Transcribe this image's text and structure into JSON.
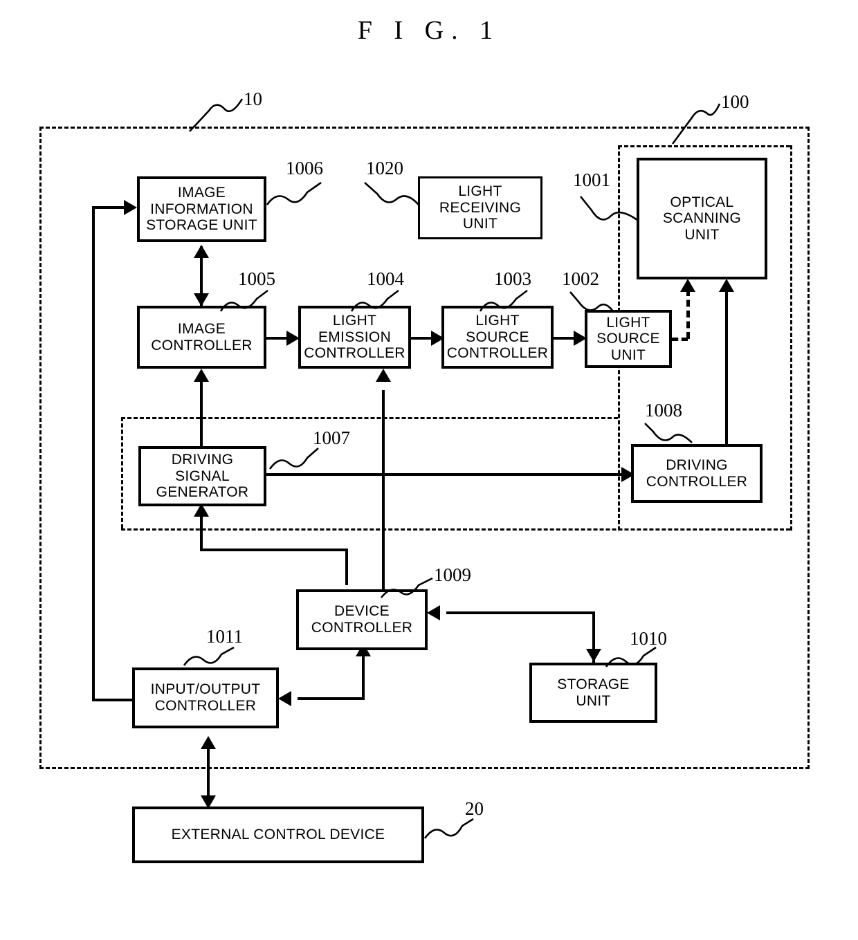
{
  "figure": {
    "title": "F I G.  1"
  },
  "regions": [
    {
      "id": "device-boundary",
      "ref": "10",
      "style": "dashed"
    },
    {
      "id": "optical-unit-boundary",
      "ref": "100",
      "style": "dash-dot"
    }
  ],
  "blocks": [
    {
      "id": "image-information-storage-unit",
      "ref": "1006",
      "label": "IMAGE\nINFORMATION\nSTORAGE UNIT"
    },
    {
      "id": "light-receiving-unit",
      "ref": "1020",
      "label": "LIGHT\nRECEIVING\nUNIT"
    },
    {
      "id": "optical-scanning-unit",
      "ref": "1001",
      "label": "OPTICAL\nSCANNING\nUNIT"
    },
    {
      "id": "image-controller",
      "ref": "1005",
      "label": "IMAGE\nCONTROLLER"
    },
    {
      "id": "light-emission-controller",
      "ref": "1004",
      "label": "LIGHT\nEMISSION\nCONTROLLER"
    },
    {
      "id": "light-source-controller",
      "ref": "1003",
      "label": "LIGHT\nSOURCE\nCONTROLLER"
    },
    {
      "id": "light-source-unit",
      "ref": "1002",
      "label": "LIGHT\nSOURCE\nUNIT"
    },
    {
      "id": "driving-signal-generator",
      "ref": "1007",
      "label": "DRIVING\nSIGNAL\nGENERATOR"
    },
    {
      "id": "driving-controller",
      "ref": "1008",
      "label": "DRIVING\nCONTROLLER"
    },
    {
      "id": "device-controller",
      "ref": "1009",
      "label": "DEVICE\nCONTROLLER"
    },
    {
      "id": "storage-unit",
      "ref": "1010",
      "label": "STORAGE\nUNIT"
    },
    {
      "id": "input-output-controller",
      "ref": "1011",
      "label": "INPUT/OUTPUT\nCONTROLLER"
    },
    {
      "id": "external-control-device",
      "ref": "20",
      "label": "EXTERNAL CONTROL DEVICE"
    }
  ],
  "refs": {
    "r10": "10",
    "r100": "100",
    "r1001": "1001",
    "r1002": "1002",
    "r1003": "1003",
    "r1004": "1004",
    "r1005": "1005",
    "r1006": "1006",
    "r1007": "1007",
    "r1008": "1008",
    "r1009": "1009",
    "r1010": "1010",
    "r1011": "1011",
    "r1020": "1020",
    "r20": "20"
  },
  "labels": {
    "image_information_storage_unit": "IMAGE\nINFORMATION\nSTORAGE UNIT",
    "light_receiving_unit": "LIGHT\nRECEIVING\nUNIT",
    "optical_scanning_unit": "OPTICAL\nSCANNING\nUNIT",
    "image_controller": "IMAGE\nCONTROLLER",
    "light_emission_controller": "LIGHT\nEMISSION\nCONTROLLER",
    "light_source_controller": "LIGHT\nSOURCE\nCONTROLLER",
    "light_source_unit": "LIGHT\nSOURCE\nUNIT",
    "driving_signal_generator": "DRIVING\nSIGNAL\nGENERATOR",
    "driving_controller": "DRIVING\nCONTROLLER",
    "device_controller": "DEVICE\nCONTROLLER",
    "storage_unit": "STORAGE\nUNIT",
    "input_output_controller": "INPUT/OUTPUT\nCONTROLLER",
    "external_control_device": "EXTERNAL CONTROL DEVICE"
  },
  "colors": {
    "line": "#000000",
    "background": "#ffffff"
  }
}
